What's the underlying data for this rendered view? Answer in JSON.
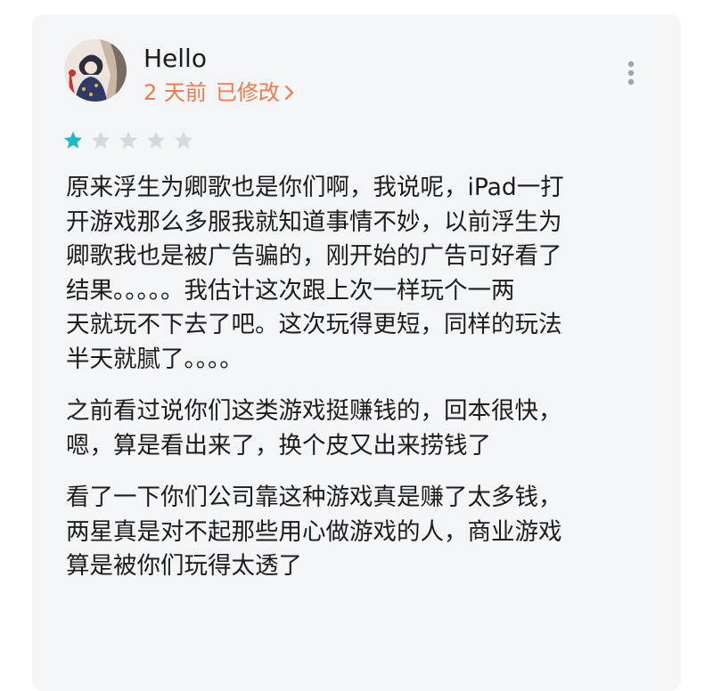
{
  "review": {
    "username": "Hello",
    "time_ago": "2 天前",
    "edited_label": "已修改",
    "rating": 1,
    "max_rating": 5,
    "paragraphs": [
      "原来浮生为卿歌也是你们啊，我说呢，iPad一打\n开游戏那么多服我就知道事情不妙，以前浮生为\n卿歌我也是被广告骗的，刚开始的广告可好看了\n结果。。。。。我估计这次跟上次一样玩个一两\n天就玩不下去了吧。这次玩得更短，同样的玩法\n半天就腻了。。。。",
      "之前看过说你们这类游戏挺赚钱的，回本很快，\n嗯，算是看出来了，换个皮又出来捞钱了",
      "看了一下你们公司靠这种游戏真是赚了太多钱，\n两星真是对不起那些用心做游戏的人，商业游戏\n算是被你们玩得太透了"
    ]
  },
  "colors": {
    "accent": "#ee7a4e",
    "star_filled": "#1fb8c6",
    "star_empty": "#d5d8dc",
    "text": "#1c1c1c",
    "card_bg": "#f4f5f7"
  },
  "icons": {
    "avatar": "user-avatar-illustration",
    "edited_chevron": "chevron-right-icon",
    "more": "more-vertical-icon",
    "star": "star-icon"
  }
}
